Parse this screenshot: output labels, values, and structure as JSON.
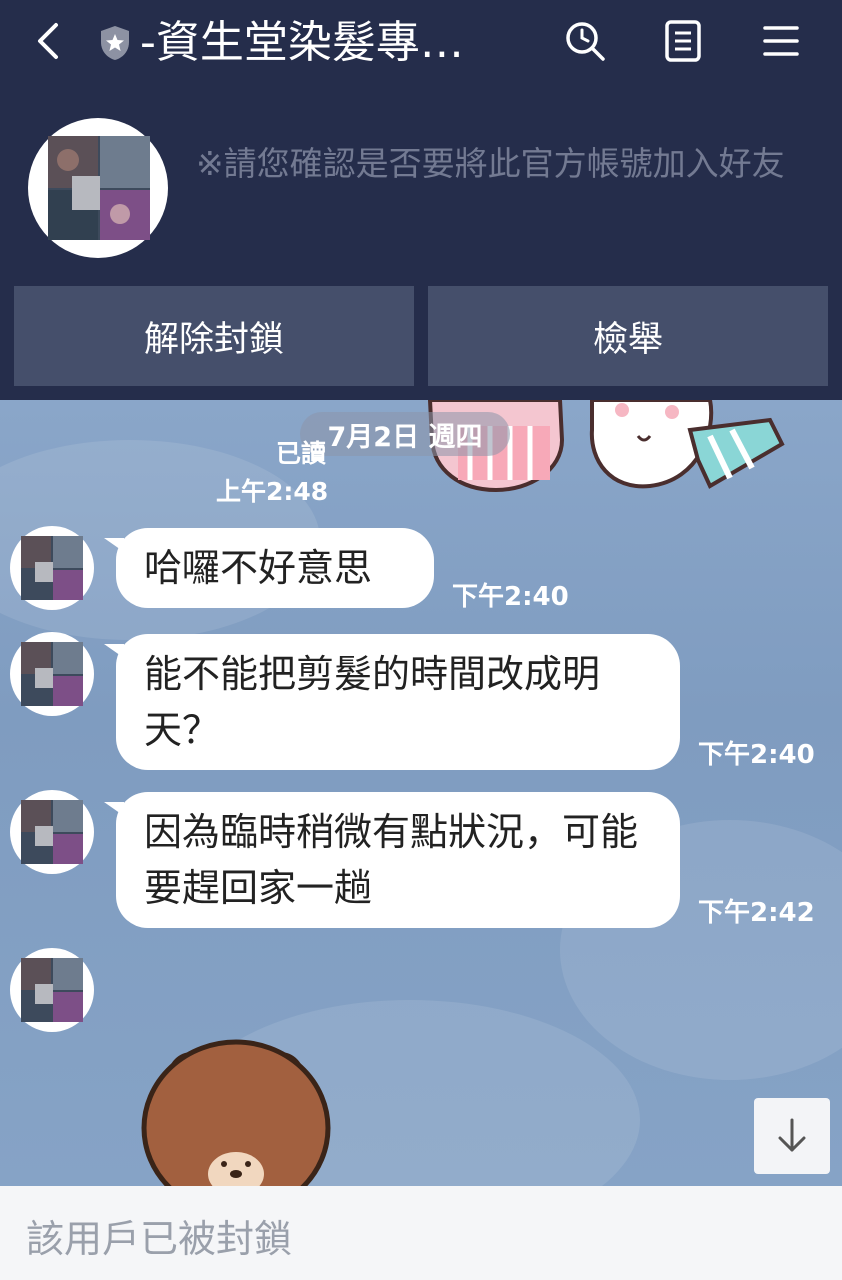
{
  "header": {
    "title": "-資生堂染髮專…",
    "back_icon": "chevron-left-icon",
    "badge_icon": "official-account-shield-icon",
    "actions": [
      "search-icon",
      "notes-icon",
      "menu-icon"
    ]
  },
  "banner": {
    "notice": "※請您確認是否要將此官方帳號加入好友",
    "unblock_label": "解除封鎖",
    "report_label": "檢舉"
  },
  "chat": {
    "date_label": "7月2日 週四",
    "read_label": "已讀",
    "read_time": "上午2:48",
    "messages": [
      {
        "text": "哈囉不好意思",
        "time": "下午2:40"
      },
      {
        "text": "能不能把剪髮的時間改成明天？",
        "time": "下午2:40"
      },
      {
        "text": "因為臨時稍微有點狀況，可能要趕回家一趟",
        "time": "下午2:42"
      }
    ]
  },
  "footer": {
    "blocked_label": "該用戶已被封鎖"
  },
  "colors": {
    "header_bg": "#252d4b",
    "button_bg": "#454f6b",
    "chat_bg": "#7f9cc0",
    "bubble_bg": "#ffffff"
  }
}
